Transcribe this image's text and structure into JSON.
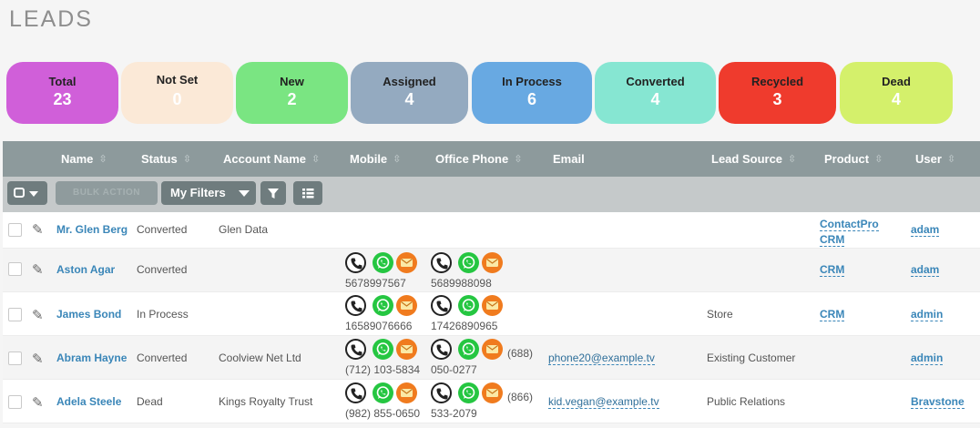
{
  "page": {
    "title": "LEADS"
  },
  "status_tiles": [
    {
      "label": "Total",
      "count": "23",
      "color": "#d05fd9"
    },
    {
      "label": "Not Set",
      "count": "0",
      "color": "#fbe9d7"
    },
    {
      "label": "New",
      "count": "2",
      "color": "#7ae582"
    },
    {
      "label": "Assigned",
      "count": "4",
      "color": "#94aac0"
    },
    {
      "label": "In Process",
      "count": "6",
      "color": "#68a9e2"
    },
    {
      "label": "Converted",
      "count": "4",
      "color": "#86e6d2"
    },
    {
      "label": "Recycled",
      "count": "3",
      "color": "#ef3b2d"
    },
    {
      "label": "Dead",
      "count": "4",
      "color": "#d4f06b"
    }
  ],
  "table": {
    "columns": [
      "Name",
      "Status",
      "Account Name",
      "Mobile",
      "Office Phone",
      "Email",
      "Lead Source",
      "Product",
      "User"
    ],
    "toolbar": {
      "bulk_action": "BULK ACTION",
      "filters": "My Filters"
    },
    "rows": [
      {
        "name": "Mr. Glen Berg",
        "status": "Converted",
        "account": "Glen Data",
        "mobile": "",
        "office": "",
        "email": "",
        "source": "",
        "product": "ContactPro CRM",
        "user": "adam"
      },
      {
        "name": "Aston Agar",
        "status": "Converted",
        "account": "",
        "mobile": "5678997567",
        "office": "5689988098",
        "email": "",
        "source": "",
        "product": "CRM",
        "user": "adam"
      },
      {
        "name": "James Bond",
        "status": "In Process",
        "account": "",
        "mobile": "16589076666",
        "office": "17426890965",
        "email": "",
        "source": "Store",
        "product": "CRM",
        "user": "admin"
      },
      {
        "name": "Abram Hayne",
        "status": "Converted",
        "account": "Coolview Net Ltd",
        "mobile": "(712) 103-5834",
        "office_prefix": "(688)",
        "office": "050-0277",
        "email": "phone20@example.tv",
        "source": "Existing Customer",
        "product": "",
        "user": "admin"
      },
      {
        "name": "Adela Steele",
        "status": "Dead",
        "account": "Kings Royalty Trust",
        "mobile": "(982) 855-0650",
        "office_prefix": "(866)",
        "office": "533-2079",
        "email": "kid.vegan@example.tv",
        "source": "Public Relations",
        "product": "",
        "user": "Bravstone"
      }
    ]
  },
  "icons": {
    "phone": "phone-icon",
    "whatsapp": "whatsapp-icon",
    "sms": "sms-icon",
    "edit": "pencil-icon",
    "sort": "sort-icon",
    "filter": "funnel-icon",
    "columns": "columns-icon"
  }
}
